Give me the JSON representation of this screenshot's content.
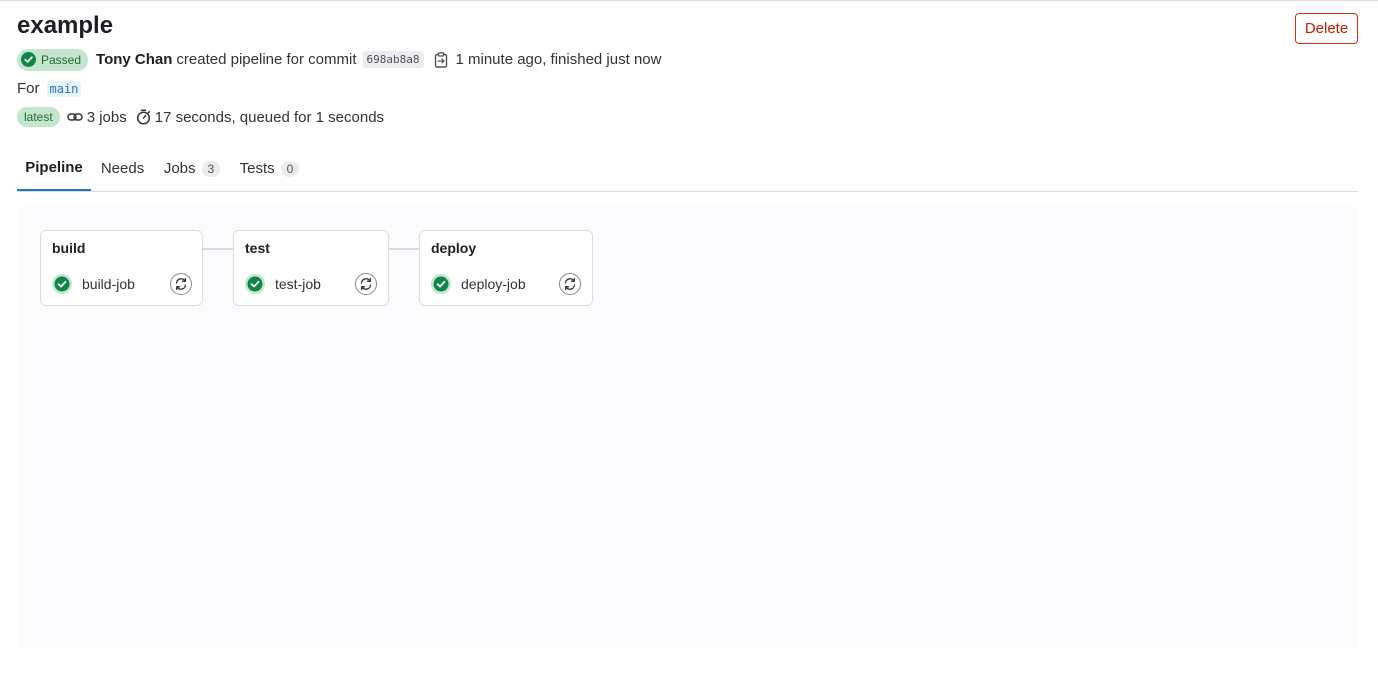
{
  "header": {
    "title": "example",
    "delete_label": "Delete"
  },
  "status": {
    "label": "Passed",
    "color": "#108548"
  },
  "commit_info": {
    "author": "Tony Chan",
    "action": "created pipeline for commit",
    "sha": "698ab8a8",
    "timing": "1 minute ago, finished just now"
  },
  "ref": {
    "prefix": "For",
    "branch": "main"
  },
  "meta": {
    "latest_badge": "latest",
    "jobs": "3 jobs",
    "duration": "17 seconds, queued for 1 seconds"
  },
  "tabs": [
    {
      "label": "Pipeline",
      "active": true
    },
    {
      "label": "Needs"
    },
    {
      "label": "Jobs",
      "count": "3"
    },
    {
      "label": "Tests",
      "count": "0"
    }
  ],
  "stages": [
    {
      "name": "build",
      "job": "build-job",
      "status": "passed"
    },
    {
      "name": "test",
      "job": "test-job",
      "status": "passed"
    },
    {
      "name": "deploy",
      "job": "deploy-job",
      "status": "passed"
    }
  ],
  "icons": {
    "status": "check-circle-icon",
    "copy": "clipboard-icon",
    "jobs": "pipeline-link-icon",
    "duration": "stopwatch-icon",
    "retry": "retry-icon"
  }
}
